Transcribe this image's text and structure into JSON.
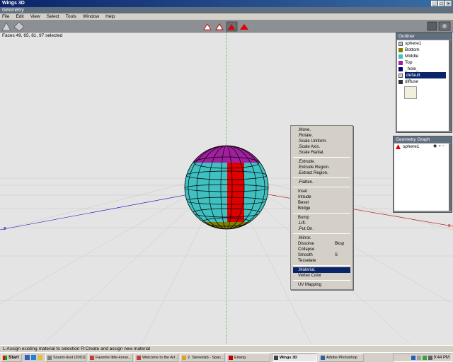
{
  "window": {
    "title": "Wings 3D",
    "buttons": [
      "_",
      "□",
      "×"
    ]
  },
  "geometry_tab": "Geometry",
  "menubar": [
    "File",
    "Edit",
    "View",
    "Select",
    "Tools",
    "Window",
    "Help"
  ],
  "selection_info": "Faces 49, 65, 81, 97 selected",
  "outliner": {
    "title": "Outliner",
    "items": [
      {
        "label": "sphere1",
        "icon": "object-icon",
        "color": "#c0c0c0"
      },
      {
        "label": "Bottom",
        "icon": "material-icon",
        "color": "#808000"
      },
      {
        "label": "Middle",
        "icon": "material-icon",
        "color": "#40c0c0"
      },
      {
        "label": "Top",
        "icon": "material-icon",
        "color": "#a020a0"
      },
      {
        "label": "_hole_",
        "icon": "material-icon",
        "color": "#000080"
      },
      {
        "label": "default",
        "icon": "material-icon",
        "color": "#d0d0d0"
      },
      {
        "label": "diffuse",
        "icon": "texture-icon",
        "color": "#303030"
      }
    ],
    "swatch_color": "#f0f0dc"
  },
  "geometry_graph": {
    "title": "Geometry Graph",
    "items": [
      {
        "label": "sphere1"
      }
    ]
  },
  "context_menu": {
    "groups": [
      [
        "Move",
        "Rotate",
        "Scale Uniform",
        "Scale Axis",
        "Scale Radial"
      ],
      [
        "Extrude",
        "Extrude Region",
        "Extract Region"
      ],
      [
        "Flatten"
      ],
      [
        "Inset",
        "Intrude",
        "Bevel",
        "Bridge"
      ],
      [
        "Bump",
        "Lift",
        "Put On"
      ],
      [
        "Mirror",
        "Dissolve",
        "Collapse",
        "Smooth",
        "Tesselate"
      ],
      [
        "Material",
        "Vertex Color"
      ],
      [
        "UV Mapping"
      ]
    ],
    "items": {
      "move": ".Move.",
      "rotate": ".Rotate.",
      "scale_uniform": ".Scale Uniform.",
      "scale_axis": ".Scale Axis.",
      "scale_radial": ".Scale Radial.",
      "extrude": ".Extrude.",
      "extrude_region": ".Extrude Region.",
      "extract_region": ".Extract Region.",
      "flatten": ".Flatten.",
      "inset": "Inset",
      "intrude": "Intrude",
      "bevel": "Bevel",
      "bridge": "Bridge",
      "bump": "Bump",
      "lift": ".Lift.",
      "put_on": ".Put On.",
      "mirror": ".Mirror.",
      "dissolve": "Dissolve",
      "dissolve_key": "Bksp",
      "collapse": "Collapse",
      "smooth": "Smooth",
      "smooth_key": "S",
      "tesselate": "Tesselate",
      "material": ".Material.",
      "vertex_color": "Vertex Color",
      "uv_mapping": "UV Mapping"
    }
  },
  "axes": {
    "z_label": "z",
    "x_label": "x"
  },
  "status": "L:Assign existing material to selection  R:Create and assign new material",
  "taskbar": {
    "start": "Start",
    "tasks": [
      "Sound-dust (2001)",
      "Favorite little-know...",
      "Welcome to the Art ...",
      "2. Stereolab - Spac...",
      "Erlang",
      "Wings 3D",
      "Adobe Photoshop"
    ],
    "clock": "9:44 PM"
  },
  "colors": {
    "sphere_top": "#a020a0",
    "sphere_middle": "#40c0c0",
    "sphere_bottom": "#808000",
    "selected_faces": "#e00000",
    "accent": "#0a246a"
  }
}
